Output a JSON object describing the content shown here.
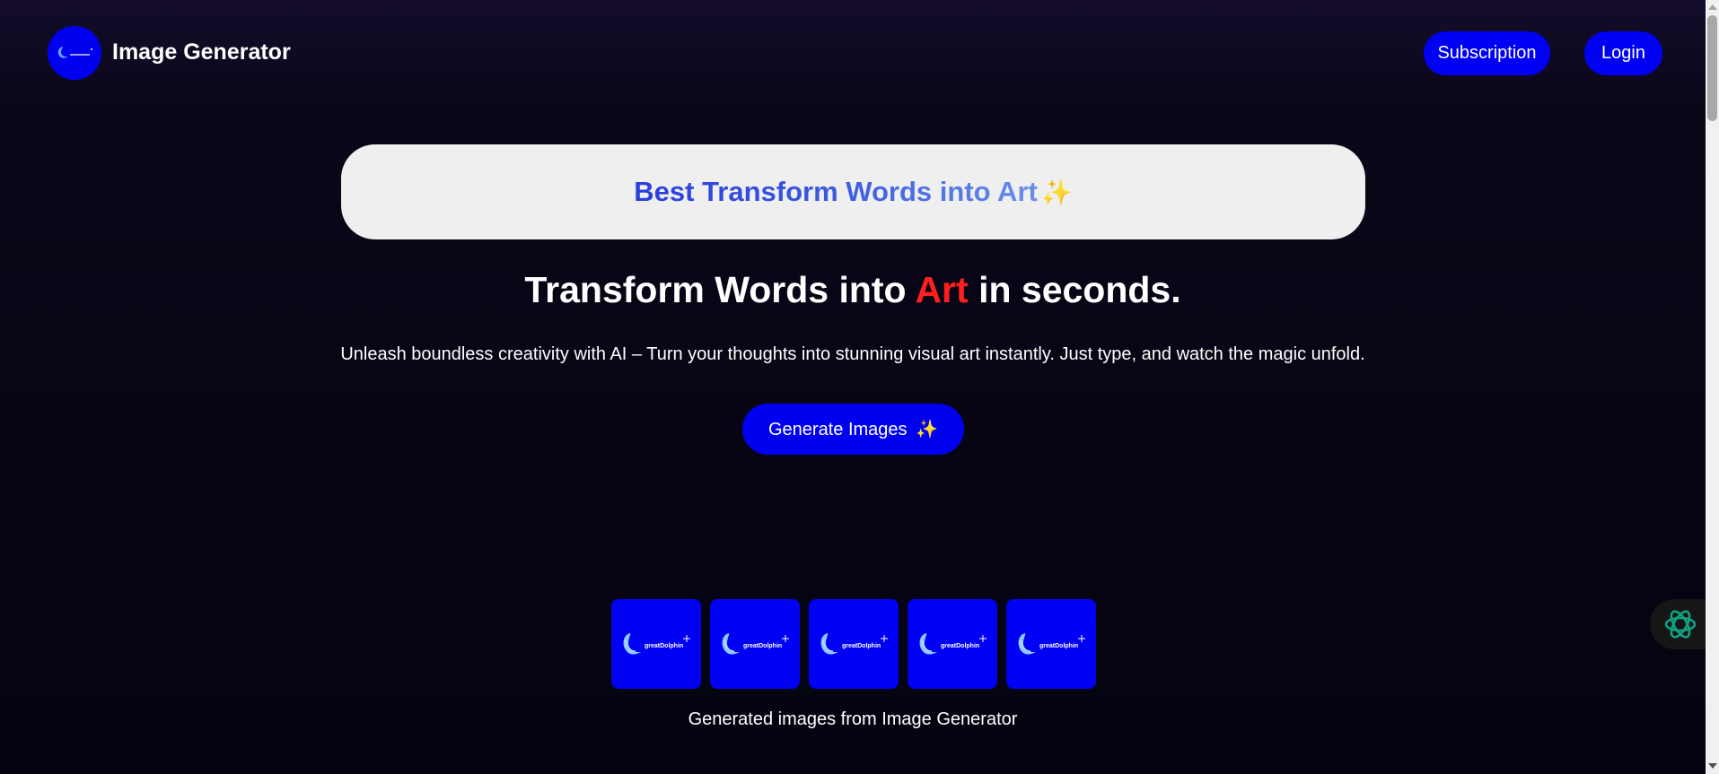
{
  "header": {
    "brand": "Image Generator",
    "nav": {
      "subscription": "Subscription",
      "login": "Login"
    }
  },
  "banner": {
    "text": "Best Transform Words into Art",
    "sparkle": "✨"
  },
  "hero": {
    "headline_before": "Transform Words into ",
    "headline_accent": "Art",
    "headline_after": " in seconds.",
    "subtext": "Unleash boundless creativity with AI – Turn your thoughts into stunning visual art instantly. Just type, and watch the magic unfold.",
    "cta_label": "Generate Images",
    "cta_sparkle": "✨"
  },
  "gallery": {
    "thumbnail_text": "greatDolphin",
    "thumbnail_count": 5,
    "caption": "Generated images from Image Generator"
  },
  "colors": {
    "primary_blue": "#0000f0",
    "accent_red": "#ff1f1f",
    "banner_bg": "#efefef",
    "page_bg": "#070513"
  },
  "icons": {
    "logo": "dolphin-logo-icon",
    "assistant": "openai-assistant-icon"
  }
}
